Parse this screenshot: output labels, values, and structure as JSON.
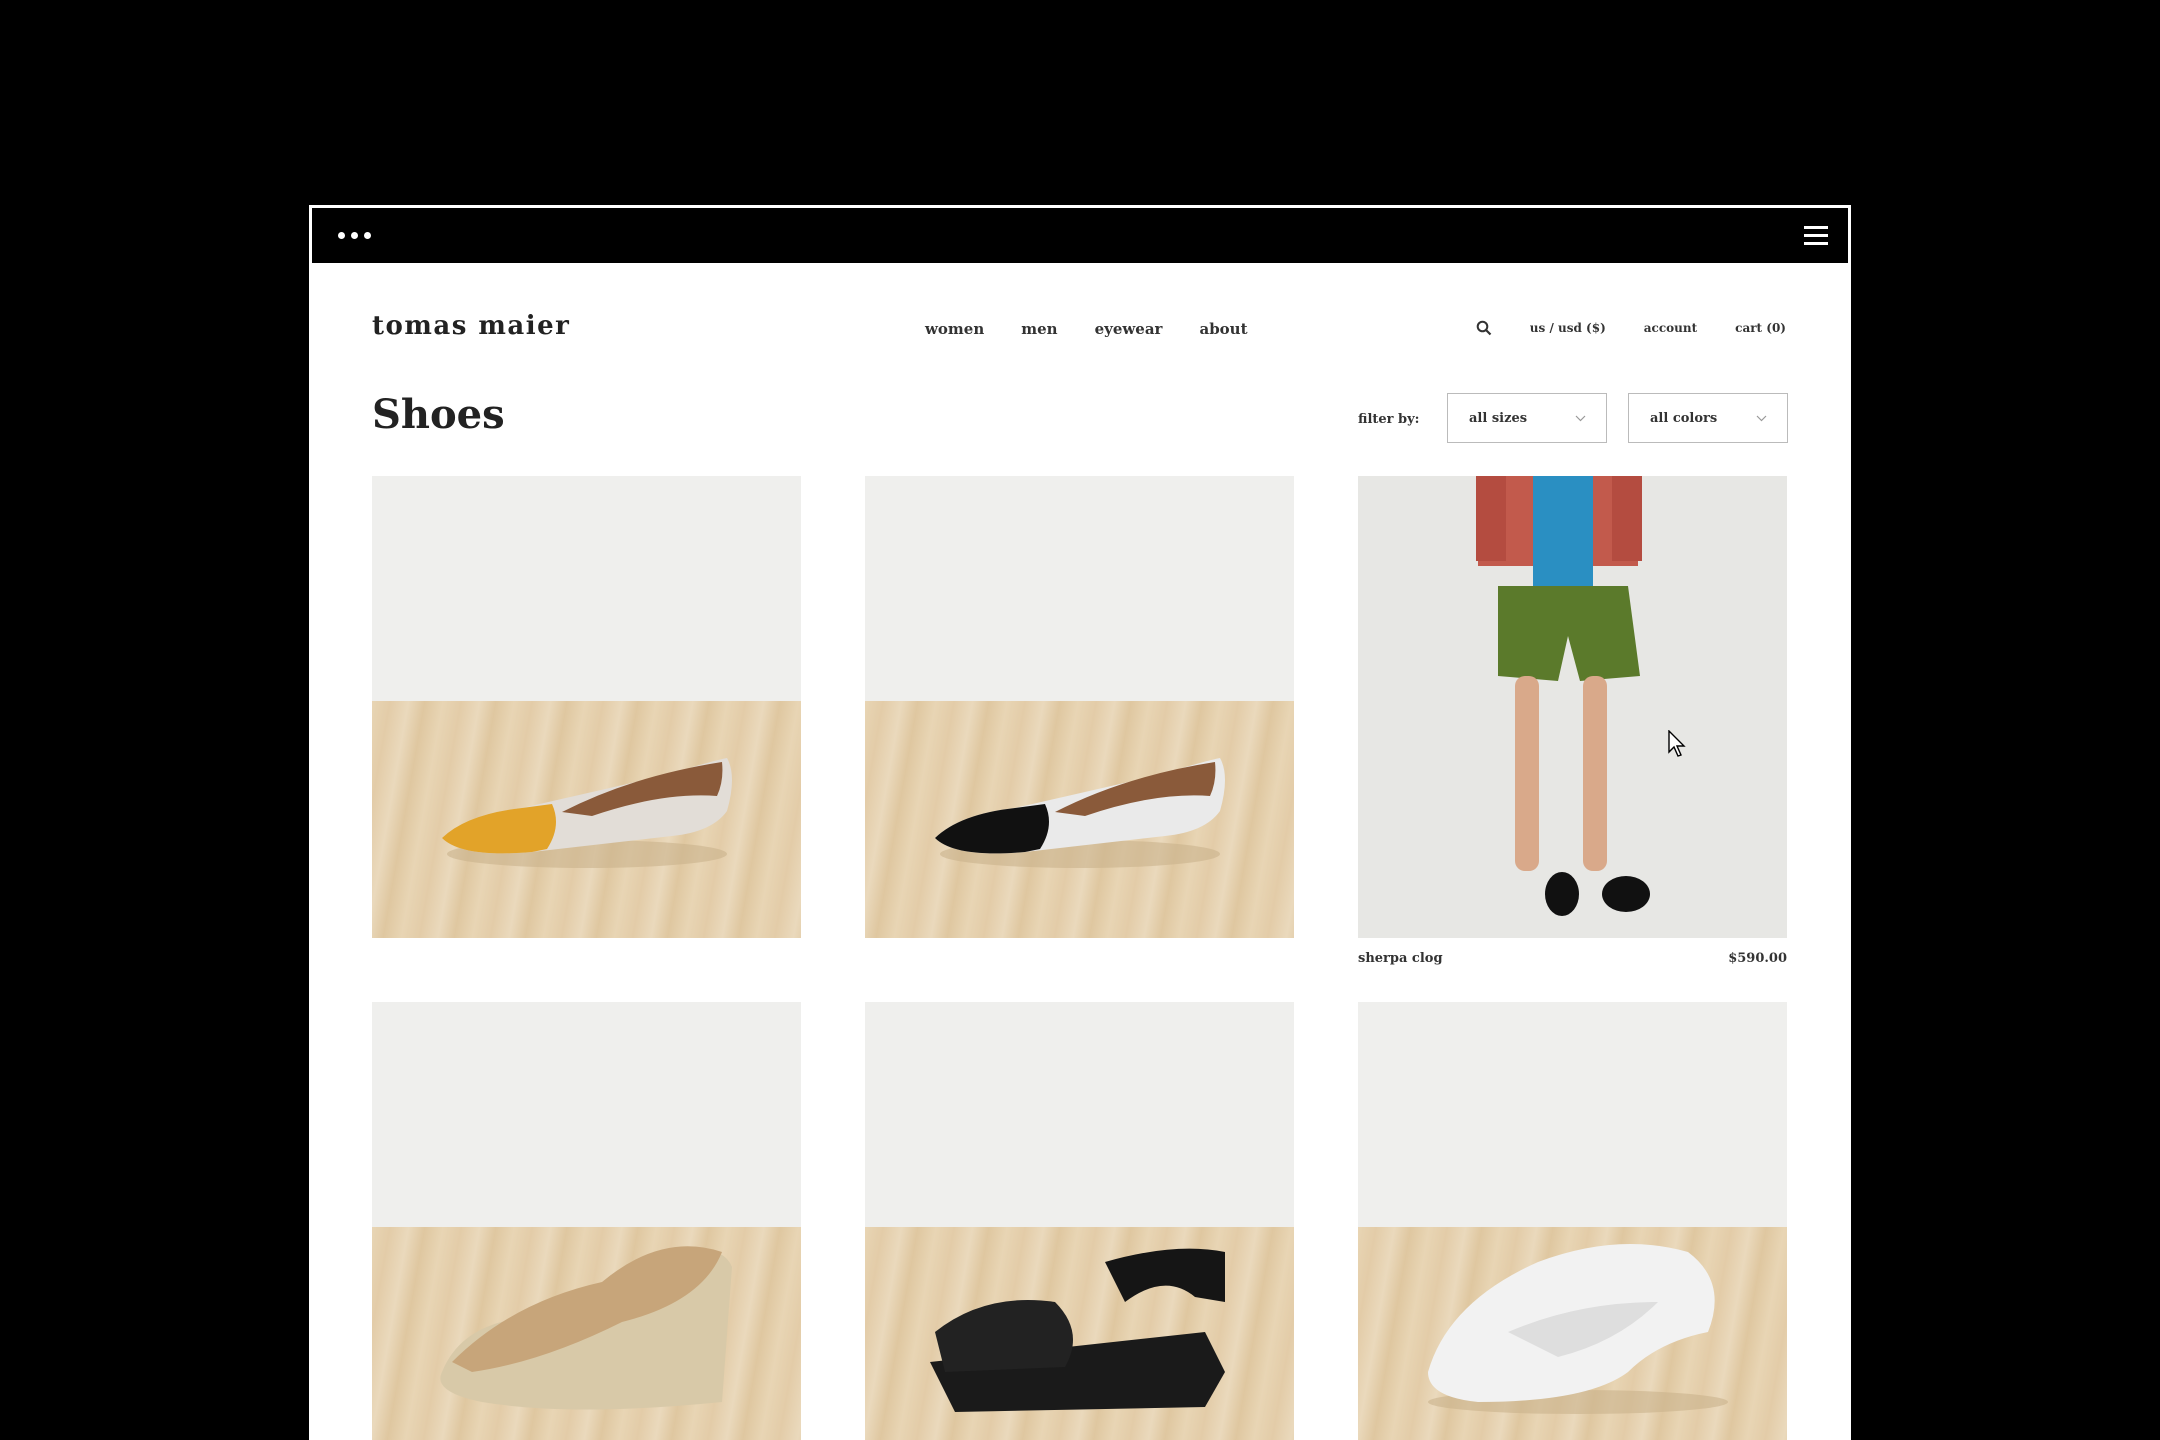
{
  "brand": "tomas maier",
  "nav": {
    "items": [
      "women",
      "men",
      "eyewear",
      "about"
    ]
  },
  "util": {
    "currency": "us / usd ($)",
    "account": "account",
    "cart": "cart (0)",
    "search_icon": "search-icon"
  },
  "page": {
    "title": "Shoes"
  },
  "filters": {
    "label": "filter by:",
    "sizes": "all sizes",
    "colors": "all colors"
  },
  "products": [
    {
      "image": "pointed flat, mustard tip",
      "name": "",
      "price": ""
    },
    {
      "image": "pointed flat, black tip",
      "name": "",
      "price": ""
    },
    {
      "image": "model wearing clogs",
      "name": "sherpa clog",
      "price": "$590.00"
    },
    {
      "image": "fur wedge loafer",
      "name": "",
      "price": ""
    },
    {
      "image": "fur strap clog sandal",
      "name": "",
      "price": ""
    },
    {
      "image": "white fur clog",
      "name": "",
      "price": ""
    }
  ],
  "colors": {
    "chrome": "#000000",
    "text": "#222222",
    "wall": "#efefed",
    "floor": "#e6d2b0"
  }
}
